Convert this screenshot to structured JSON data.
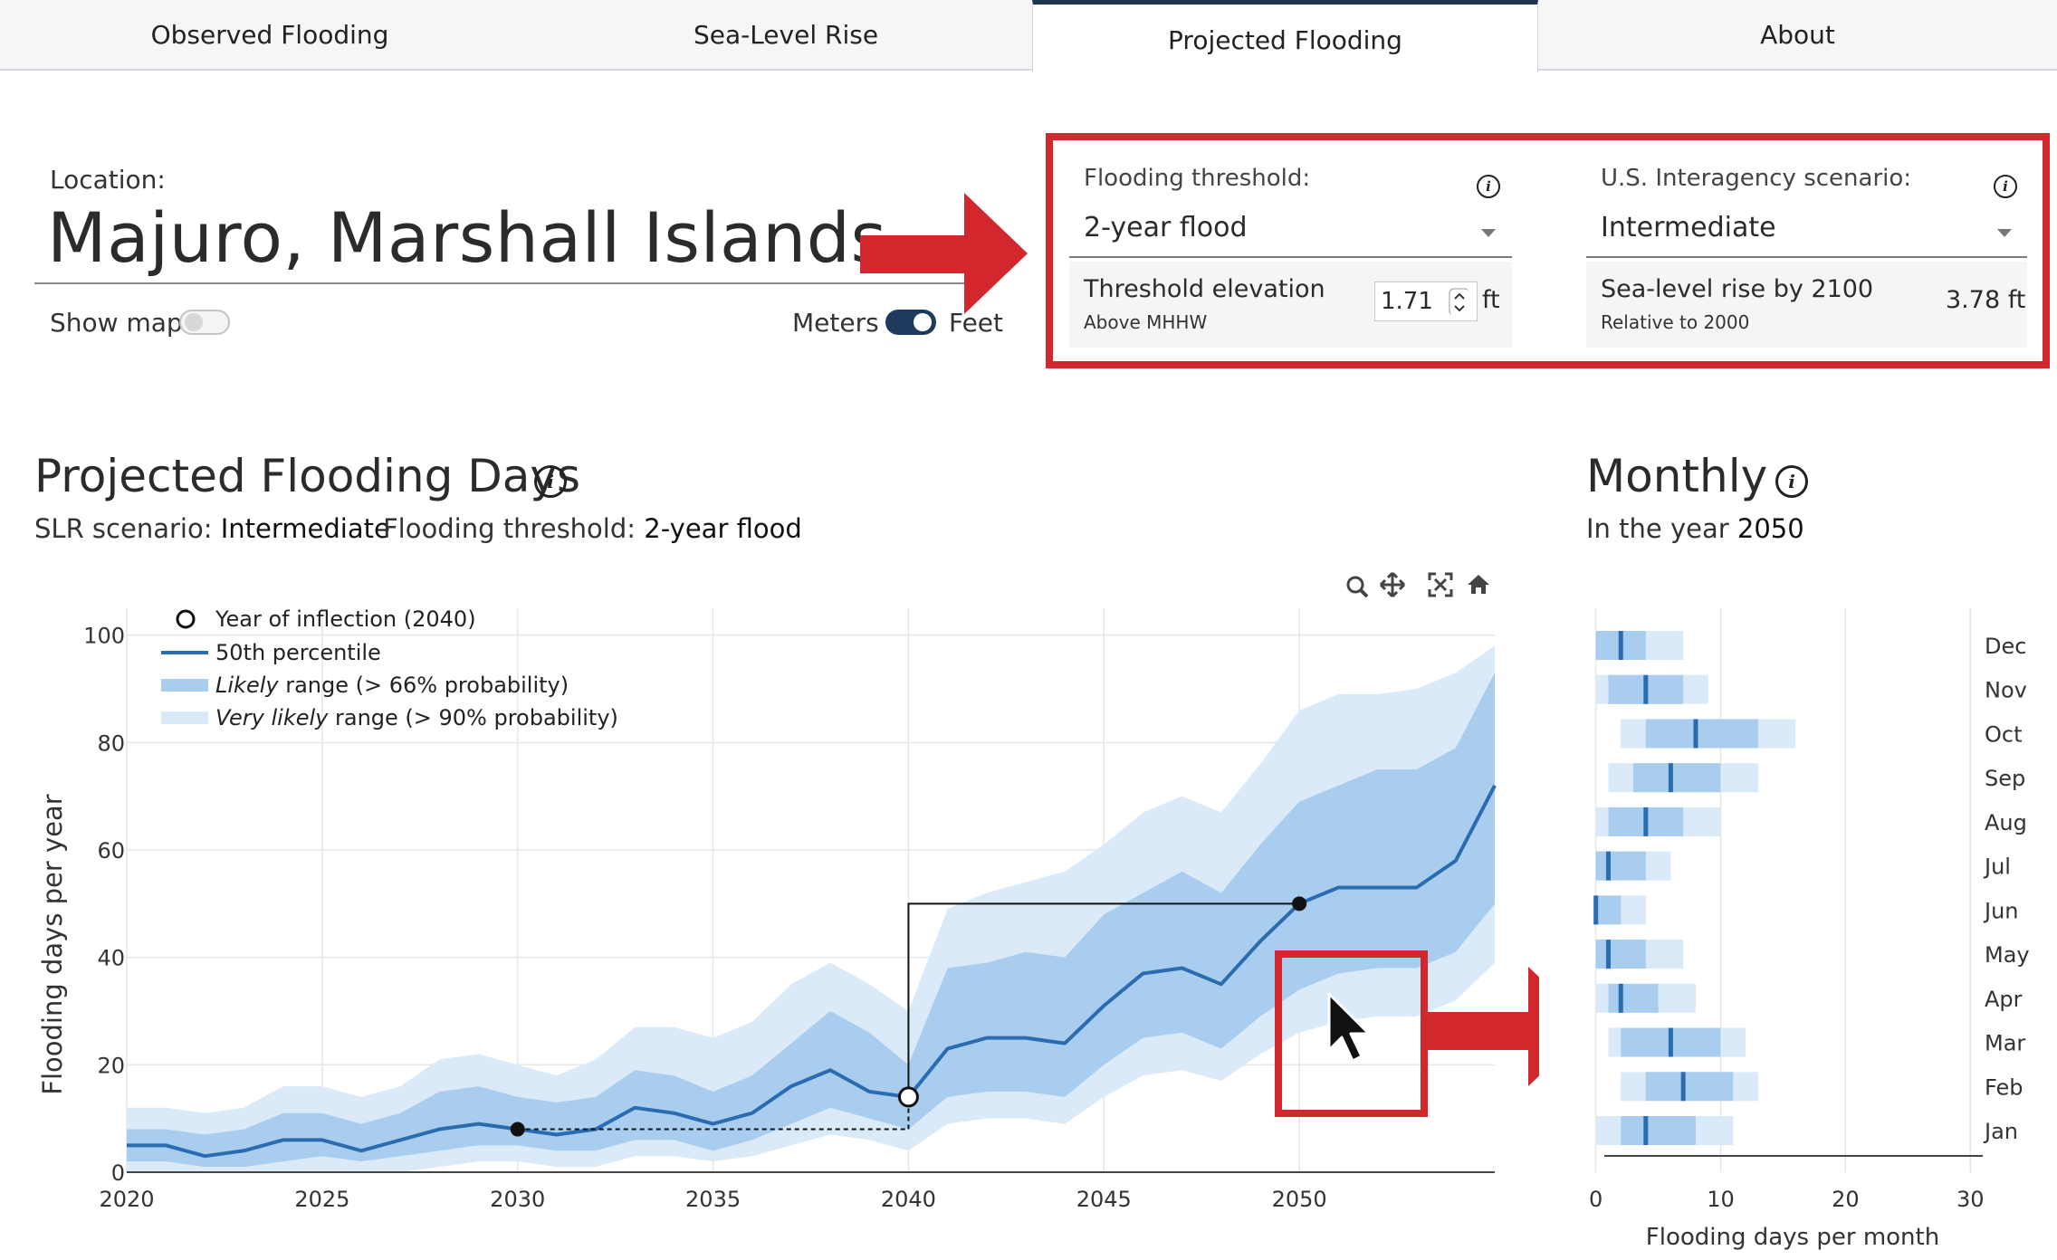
{
  "tabs": [
    {
      "label": "Observed Flooding",
      "active": false
    },
    {
      "label": "Sea-Level Rise",
      "active": false
    },
    {
      "label": "Projected Flooding",
      "active": true
    },
    {
      "label": "About",
      "active": false
    }
  ],
  "location": {
    "label": "Location:",
    "name": "Majuro, Marshall Islands",
    "show_map_label": "Show map",
    "show_map_on": false,
    "units_left": "Meters",
    "units_right": "Feet",
    "feet_on": true
  },
  "controls": {
    "threshold_label": "Flooding threshold:",
    "threshold_value": "2-year flood",
    "elevation_title": "Threshold elevation",
    "elevation_sub": "Above MHHW",
    "elevation_value": "1.71",
    "elevation_unit": "ft",
    "scenario_label": "U.S. Interagency scenario:",
    "scenario_value": "Intermediate",
    "slr_title": "Sea-level rise by 2100",
    "slr_sub": "Relative to 2000",
    "slr_value": "3.78 ft"
  },
  "projected": {
    "title": "Projected Flooding Days",
    "scenario_prefix": "SLR scenario:",
    "scenario_value": "Intermediate",
    "threshold_prefix": "Flooding threshold:",
    "threshold_value": "2-year flood"
  },
  "monthly": {
    "title": "Monthly",
    "year_prefix": "In the year",
    "year_value": "2050"
  },
  "colors": {
    "accent_red": "#d3272e",
    "median_line": "#2b6cb0",
    "likely_band": "#a9cdee",
    "very_likely_band": "#dbeaf8",
    "tab_active_border": "#1e3550"
  },
  "toolbar_icons": [
    "zoom-icon",
    "pan-icon",
    "autoscale-icon",
    "home-icon"
  ],
  "chart_data": [
    {
      "type": "area",
      "title": "",
      "xlabel": "",
      "ylabel": "Flooding days per year",
      "xlim": [
        2020,
        2055
      ],
      "ylim": [
        0,
        105
      ],
      "x_ticks": [
        2020,
        2025,
        2030,
        2035,
        2040,
        2045,
        2050
      ],
      "y_ticks": [
        0,
        20,
        40,
        60,
        80,
        100
      ],
      "grid": true,
      "legend_position": "top-left",
      "legend": [
        {
          "marker": "circle",
          "label": "Year of inflection (2040)"
        },
        {
          "marker": "line",
          "label": "50th percentile"
        },
        {
          "marker": "band",
          "label_em": "Likely",
          "label_rest": " range (> 66% probability)"
        },
        {
          "marker": "band-light",
          "label_em": "Very likely",
          "label_rest": " range (> 90% probability)"
        }
      ],
      "x": [
        2020,
        2021,
        2022,
        2023,
        2024,
        2025,
        2026,
        2027,
        2028,
        2029,
        2030,
        2031,
        2032,
        2033,
        2034,
        2035,
        2036,
        2037,
        2038,
        2039,
        2040,
        2041,
        2042,
        2043,
        2044,
        2045,
        2046,
        2047,
        2048,
        2049,
        2050,
        2051,
        2052,
        2053,
        2054,
        2055
      ],
      "series": [
        {
          "name": "50th percentile",
          "values": [
            5,
            5,
            3,
            4,
            6,
            6,
            4,
            6,
            8,
            9,
            8,
            7,
            8,
            12,
            11,
            9,
            11,
            16,
            19,
            15,
            14,
            23,
            25,
            25,
            24,
            31,
            37,
            38,
            35,
            43,
            50,
            53,
            53,
            53,
            58,
            72
          ]
        },
        {
          "name": "Likely range (> 66% probability)",
          "lower": [
            2,
            2,
            1,
            1,
            2,
            3,
            2,
            3,
            4,
            5,
            5,
            4,
            4,
            6,
            6,
            4,
            6,
            9,
            12,
            10,
            8,
            14,
            15,
            15,
            14,
            20,
            25,
            26,
            23,
            29,
            34,
            37,
            38,
            38,
            41,
            50
          ],
          "upper": [
            8,
            8,
            7,
            8,
            11,
            11,
            9,
            11,
            15,
            16,
            14,
            13,
            14,
            19,
            18,
            15,
            18,
            24,
            30,
            26,
            20,
            38,
            39,
            41,
            40,
            48,
            52,
            56,
            52,
            61,
            69,
            72,
            75,
            75,
            79,
            93
          ]
        },
        {
          "name": "Very likely range (> 90% probability)",
          "lower": [
            0,
            0,
            0,
            0,
            0,
            0,
            0,
            0,
            1,
            2,
            2,
            1,
            1,
            3,
            3,
            2,
            3,
            5,
            7,
            6,
            4,
            9,
            10,
            10,
            9,
            14,
            18,
            19,
            17,
            22,
            26,
            28,
            29,
            29,
            32,
            39
          ],
          "upper": [
            12,
            12,
            11,
            12,
            16,
            16,
            14,
            16,
            21,
            22,
            20,
            18,
            21,
            27,
            27,
            25,
            28,
            35,
            39,
            35,
            30,
            49,
            52,
            54,
            56,
            61,
            67,
            70,
            67,
            76,
            86,
            89,
            89,
            90,
            93,
            98
          ]
        }
      ],
      "annotations": [
        {
          "kind": "point",
          "x": 2030,
          "y": 8
        },
        {
          "kind": "inflection",
          "x": 2040,
          "y": 14
        },
        {
          "kind": "point",
          "x": 2050,
          "y": 50
        }
      ]
    },
    {
      "type": "bar",
      "title": "",
      "xlabel": "Flooding days per month",
      "ylabel": "",
      "xlim": [
        -1.5,
        31
      ],
      "x_ticks": [
        0,
        10,
        20,
        30
      ],
      "grid": true,
      "categories": [
        "Dec",
        "Nov",
        "Oct",
        "Sep",
        "Aug",
        "Jul",
        "Jun",
        "May",
        "Apr",
        "Mar",
        "Feb",
        "Jan"
      ],
      "series": [
        {
          "name": "median",
          "values": [
            2,
            4,
            8,
            6,
            4,
            1,
            0,
            1,
            2,
            6,
            7,
            4
          ]
        },
        {
          "name": "likely_low",
          "values": [
            0,
            1,
            4,
            3,
            1,
            0,
            0,
            0,
            1,
            2,
            4,
            2
          ]
        },
        {
          "name": "likely_high",
          "values": [
            4,
            7,
            13,
            10,
            7,
            4,
            2,
            4,
            5,
            10,
            11,
            8
          ]
        },
        {
          "name": "very_likely_low",
          "values": [
            0,
            0,
            2,
            1,
            0,
            0,
            0,
            0,
            0,
            1,
            2,
            0
          ]
        },
        {
          "name": "very_likely_high",
          "values": [
            7,
            9,
            16,
            13,
            10,
            6,
            4,
            7,
            8,
            12,
            13,
            11
          ]
        }
      ]
    }
  ]
}
